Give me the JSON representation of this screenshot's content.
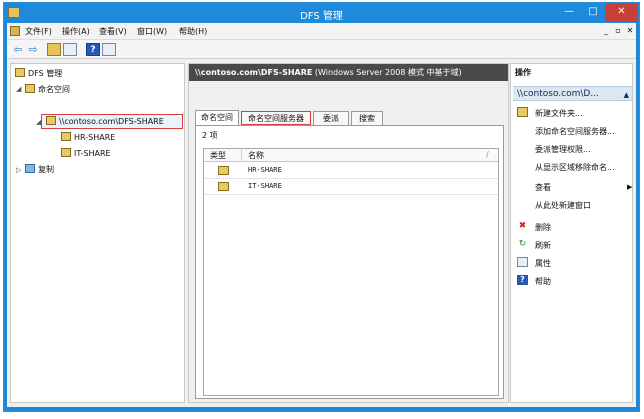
{
  "window": {
    "title": "DFS 管理",
    "minimize_glyph": "—",
    "maximize_glyph": "□",
    "close_glyph": "✕"
  },
  "menu": {
    "items": [
      "文件(F)",
      "操作(A)",
      "查看(V)",
      "窗口(W)",
      "帮助(H)"
    ],
    "mdi_minimize": "_",
    "mdi_restore": "▫",
    "mdi_close": "✕"
  },
  "toolbar": {
    "back_glyph": "⇦",
    "forward_glyph": "⇨",
    "help_glyph": "?"
  },
  "tree": {
    "root": "DFS 管理",
    "namespaces": "命名空间",
    "selected_namespace": "\\\\contoso.com\\DFS-SHARE",
    "children": [
      "HR-SHARE",
      "IT-SHARE"
    ],
    "replication": "复制"
  },
  "center": {
    "header_path": "\\\\contoso.com\\DFS-SHARE",
    "header_info": "(Windows Server 2008 模式 中基于域)",
    "tabs": [
      "命名空间",
      "命名空间服务器",
      "委派",
      "搜索"
    ],
    "item_count": "2 项",
    "columns": [
      "类型",
      "名称"
    ],
    "rows": [
      {
        "name": "HR-SHARE",
        "icon": "folder-icon"
      },
      {
        "name": "IT-SHARE",
        "icon": "folder-icon"
      }
    ]
  },
  "actions": {
    "title": "操作",
    "subtitle": "\\\\contoso.com\\D...",
    "items": [
      {
        "label": "新建文件夹...",
        "icon": "new-folder-icon"
      },
      {
        "label": "添加命名空间服务器...",
        "icon": ""
      },
      {
        "label": "委派管理权限...",
        "icon": ""
      },
      {
        "label": "从显示区域移除命名...",
        "icon": ""
      },
      {
        "label": "查看",
        "icon": ""
      },
      {
        "label": "从此处新建窗口",
        "icon": ""
      },
      {
        "label": "删除",
        "icon": "delete-icon"
      },
      {
        "label": "刷新",
        "icon": "refresh-icon"
      },
      {
        "label": "属性",
        "icon": "properties-icon"
      },
      {
        "label": "帮助",
        "icon": "help-icon"
      }
    ]
  },
  "colors": {
    "titlebar": "#1f8ad9",
    "close_button": "#c7403a",
    "highlight_border": "#d84040",
    "center_header": "#4a4a4a"
  }
}
